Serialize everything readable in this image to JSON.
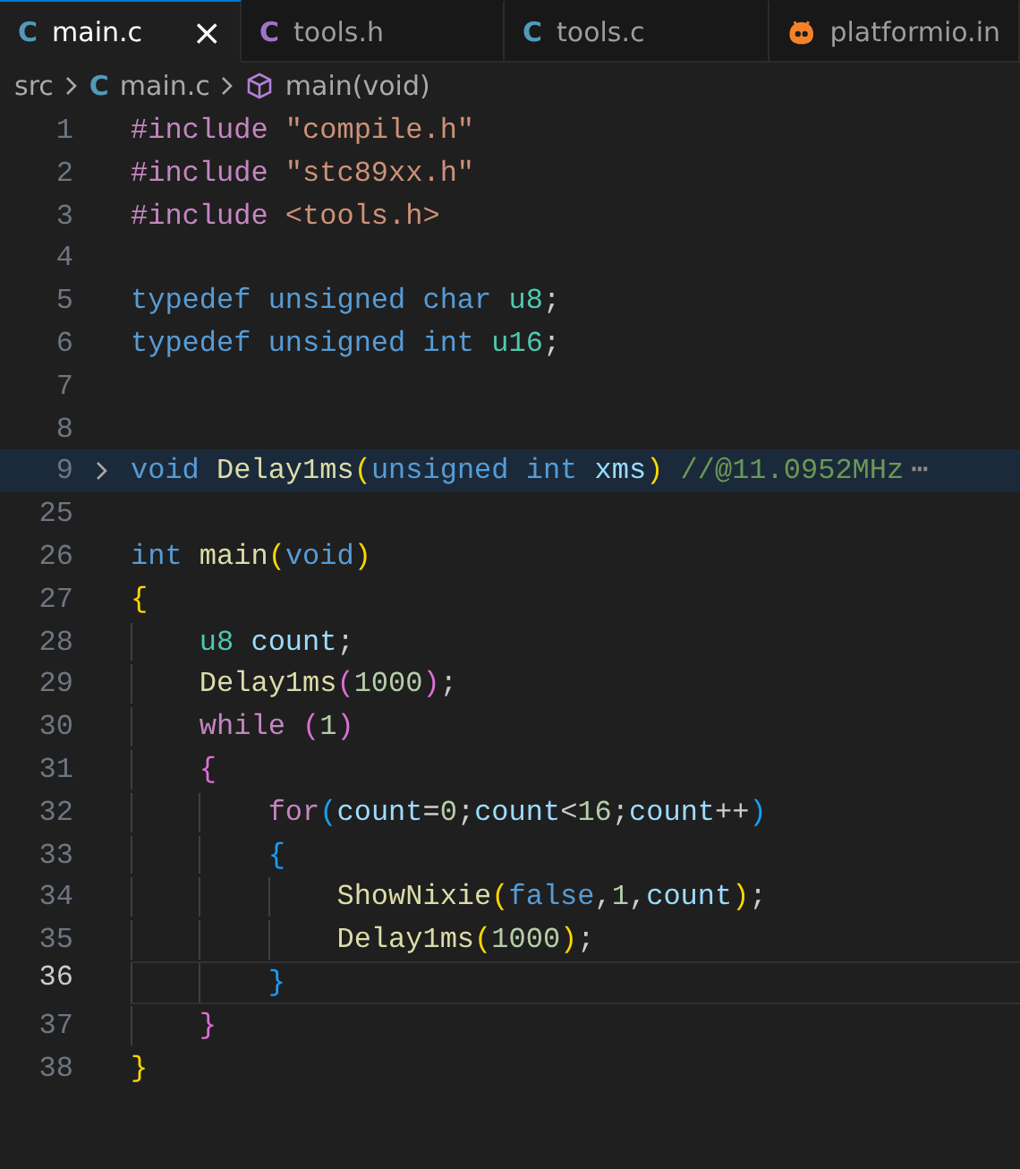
{
  "tabs": [
    {
      "label": "main.c",
      "kind": "source",
      "icon_text": "C",
      "selected": true,
      "close": "×"
    },
    {
      "label": "tools.h",
      "kind": "header",
      "icon_text": "C",
      "selected": false
    },
    {
      "label": "tools.c",
      "kind": "source",
      "icon_text": "C",
      "selected": false
    },
    {
      "label": "platformio.in",
      "kind": "config",
      "selected": false
    }
  ],
  "breadcrumb": [
    {
      "label": "src",
      "kind": "folder"
    },
    {
      "label": "main.c",
      "kind": "source",
      "icon_text": "C"
    },
    {
      "label": "main(void)",
      "kind": "function"
    }
  ],
  "lines": [
    {
      "number": "1",
      "tokens": [
        {
          "kind": "control",
          "text": "#include"
        },
        {
          "kind": "string",
          "text": " \"compile.h\""
        }
      ]
    },
    {
      "number": "2",
      "tokens": [
        {
          "kind": "control",
          "text": "#include"
        },
        {
          "kind": "string",
          "text": " \"stc89xx.h\""
        }
      ]
    },
    {
      "number": "3",
      "tokens": [
        {
          "kind": "control",
          "text": "#include"
        },
        {
          "kind": "string",
          "text": " <tools.h>"
        }
      ]
    },
    {
      "number": "4"
    },
    {
      "number": "5",
      "tokens": [
        {
          "kind": "keyword",
          "text": "typedef unsigned char"
        },
        {
          "kind": "type",
          "text": " u8"
        },
        {
          "kind": "punct",
          "text": ";"
        }
      ]
    },
    {
      "number": "6",
      "tokens": [
        {
          "kind": "keyword",
          "text": "typedef unsigned int"
        },
        {
          "kind": "type",
          "text": " u16"
        },
        {
          "kind": "punct",
          "text": ";"
        }
      ]
    },
    {
      "number": "7"
    },
    {
      "number": "8"
    },
    {
      "number": "9",
      "folded": true,
      "fold_mark": "⋯",
      "tokens": [
        {
          "kind": "keyword",
          "text": "void"
        },
        {
          "kind": "func",
          "text": " Delay1ms"
        },
        {
          "kind": "bracket1",
          "text": "("
        },
        {
          "kind": "keyword",
          "text": "unsigned int"
        },
        {
          "kind": "var",
          "text": " xms"
        },
        {
          "kind": "bracket1",
          "text": ")"
        },
        {
          "kind": "comment",
          "text": " //@11.0952MHz"
        }
      ]
    },
    {
      "number": "25"
    },
    {
      "number": "26",
      "tokens": [
        {
          "kind": "keyword",
          "text": "int"
        },
        {
          "kind": "func",
          "text": " main"
        },
        {
          "kind": "bracket1",
          "text": "("
        },
        {
          "kind": "keyword",
          "text": "void"
        },
        {
          "kind": "bracket1",
          "text": ")"
        }
      ]
    },
    {
      "number": "27",
      "tokens": [
        {
          "kind": "bracket1",
          "text": "{"
        }
      ]
    },
    {
      "number": "28",
      "tokens": [
        {
          "kind": "type",
          "text": "    u8"
        },
        {
          "kind": "var",
          "text": " count"
        },
        {
          "kind": "punct",
          "text": ";"
        }
      ]
    },
    {
      "number": "29",
      "tokens": [
        {
          "kind": "func",
          "text": "    Delay1ms"
        },
        {
          "kind": "bracket2",
          "text": "("
        },
        {
          "kind": "number",
          "text": "1000"
        },
        {
          "kind": "bracket2",
          "text": ")"
        },
        {
          "kind": "punct",
          "text": ";"
        }
      ]
    },
    {
      "number": "30",
      "tokens": [
        {
          "kind": "control",
          "text": "    while"
        },
        {
          "kind": "bracket2",
          "text": " ("
        },
        {
          "kind": "number",
          "text": "1"
        },
        {
          "kind": "bracket2",
          "text": ")"
        }
      ]
    },
    {
      "number": "31",
      "tokens": [
        {
          "kind": "bracket2",
          "text": "    {"
        }
      ]
    },
    {
      "number": "32",
      "tokens": [
        {
          "kind": "control",
          "text": "        for"
        },
        {
          "kind": "bracket3",
          "text": "("
        },
        {
          "kind": "var",
          "text": "count"
        },
        {
          "kind": "punct",
          "text": "="
        },
        {
          "kind": "number",
          "text": "0"
        },
        {
          "kind": "punct",
          "text": ";"
        },
        {
          "kind": "var",
          "text": "count"
        },
        {
          "kind": "punct",
          "text": "<"
        },
        {
          "kind": "number",
          "text": "16"
        },
        {
          "kind": "punct",
          "text": ";"
        },
        {
          "kind": "var",
          "text": "count"
        },
        {
          "kind": "punct",
          "text": "++"
        },
        {
          "kind": "bracket3",
          "text": ")"
        }
      ]
    },
    {
      "number": "33",
      "tokens": [
        {
          "kind": "bracket3",
          "text": "        {"
        }
      ]
    },
    {
      "number": "34",
      "tokens": [
        {
          "kind": "func",
          "text": "            ShowNixie"
        },
        {
          "kind": "bracket1",
          "text": "("
        },
        {
          "kind": "keyword",
          "text": "false"
        },
        {
          "kind": "punct",
          "text": ","
        },
        {
          "kind": "number",
          "text": "1"
        },
        {
          "kind": "punct",
          "text": ","
        },
        {
          "kind": "var",
          "text": "count"
        },
        {
          "kind": "bracket1",
          "text": ")"
        },
        {
          "kind": "punct",
          "text": ";"
        }
      ]
    },
    {
      "number": "35",
      "tokens": [
        {
          "kind": "func",
          "text": "            Delay1ms"
        },
        {
          "kind": "bracket1",
          "text": "("
        },
        {
          "kind": "number",
          "text": "1000"
        },
        {
          "kind": "bracket1",
          "text": ")"
        },
        {
          "kind": "punct",
          "text": ";"
        }
      ]
    },
    {
      "number": "36",
      "current": true,
      "tokens": [
        {
          "kind": "bracket3",
          "text": "        }"
        }
      ]
    },
    {
      "number": "37",
      "tokens": [
        {
          "kind": "bracket2",
          "text": "    }"
        }
      ]
    },
    {
      "number": "38",
      "tokens": [
        {
          "kind": "bracket1",
          "text": "}"
        }
      ]
    }
  ]
}
